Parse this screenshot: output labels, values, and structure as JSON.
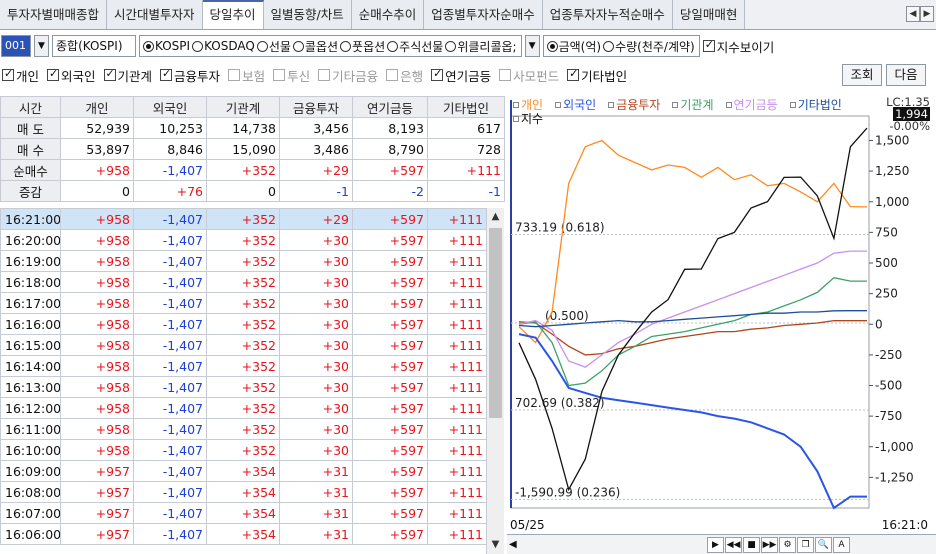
{
  "tabs": [
    "투자자별매매종합",
    "시간대별투자자",
    "당일추이",
    "일별동향/차트",
    "순매수추이",
    "업종별투자자순매수",
    "업종투자자누적순매수",
    "당일매매현"
  ],
  "tab_arrows": [
    "◀",
    "▶"
  ],
  "toolbar": {
    "code": "001",
    "code_dropdown": "▼",
    "market_select": "종합(KOSPI)",
    "market_radios": [
      "KOSPI",
      "KOSDAQ",
      "선물",
      "콜옵션",
      "풋옵션",
      "주식선물",
      "위클리콜옵;"
    ],
    "market_selected": "KOSPI",
    "market_dropdown": "▼",
    "unit_radios": [
      "금액(억)",
      "수량(천주/계약)"
    ],
    "unit_selected": "금액(억)",
    "show_index_label": "지수보이기",
    "show_index_checked": true
  },
  "filters": [
    {
      "label": "개인",
      "checked": true
    },
    {
      "label": "외국인",
      "checked": true
    },
    {
      "label": "기관계",
      "checked": true
    },
    {
      "label": "금융투자",
      "checked": true
    },
    {
      "label": "보험",
      "checked": false
    },
    {
      "label": "투신",
      "checked": false
    },
    {
      "label": "기타금융",
      "checked": false
    },
    {
      "label": "은행",
      "checked": false
    },
    {
      "label": "연기금등",
      "checked": true
    },
    {
      "label": "사모펀드",
      "checked": false
    },
    {
      "label": "기타법인",
      "checked": true
    }
  ],
  "buttons": {
    "query": "조회",
    "next": "다음"
  },
  "summary": {
    "headers": [
      "시간",
      "개인",
      "외국인",
      "기관계",
      "금융투자",
      "연기금등",
      "기타법인"
    ],
    "rows": [
      {
        "label": "매 도",
        "values": [
          "52,939",
          "10,253",
          "14,738",
          "3,456",
          "8,193",
          "617"
        ]
      },
      {
        "label": "매 수",
        "values": [
          "53,897",
          "8,846",
          "15,090",
          "3,486",
          "8,790",
          "728"
        ]
      },
      {
        "label": "순매수",
        "values": [
          "+958",
          "-1,407",
          "+352",
          "+29",
          "+597",
          "+111"
        ]
      },
      {
        "label": "증감",
        "values": [
          "0",
          "+76",
          "0",
          "-1",
          "-2",
          "-1"
        ]
      }
    ]
  },
  "timeseries": [
    {
      "time": "16:21:00",
      "values": [
        "+958",
        "-1,407",
        "+352",
        "+29",
        "+597",
        "+111"
      ]
    },
    {
      "time": "16:20:00",
      "values": [
        "+958",
        "-1,407",
        "+352",
        "+30",
        "+597",
        "+111"
      ]
    },
    {
      "time": "16:19:00",
      "values": [
        "+958",
        "-1,407",
        "+352",
        "+30",
        "+597",
        "+111"
      ]
    },
    {
      "time": "16:18:00",
      "values": [
        "+958",
        "-1,407",
        "+352",
        "+30",
        "+597",
        "+111"
      ]
    },
    {
      "time": "16:17:00",
      "values": [
        "+958",
        "-1,407",
        "+352",
        "+30",
        "+597",
        "+111"
      ]
    },
    {
      "time": "16:16:00",
      "values": [
        "+958",
        "-1,407",
        "+352",
        "+30",
        "+597",
        "+111"
      ]
    },
    {
      "time": "16:15:00",
      "values": [
        "+958",
        "-1,407",
        "+352",
        "+30",
        "+597",
        "+111"
      ]
    },
    {
      "time": "16:14:00",
      "values": [
        "+958",
        "-1,407",
        "+352",
        "+30",
        "+597",
        "+111"
      ]
    },
    {
      "time": "16:13:00",
      "values": [
        "+958",
        "-1,407",
        "+352",
        "+30",
        "+597",
        "+111"
      ]
    },
    {
      "time": "16:12:00",
      "values": [
        "+958",
        "-1,407",
        "+352",
        "+30",
        "+597",
        "+111"
      ]
    },
    {
      "time": "16:11:00",
      "values": [
        "+958",
        "-1,407",
        "+352",
        "+30",
        "+597",
        "+111"
      ]
    },
    {
      "time": "16:10:00",
      "values": [
        "+958",
        "-1,407",
        "+352",
        "+30",
        "+597",
        "+111"
      ]
    },
    {
      "time": "16:09:00",
      "values": [
        "+957",
        "-1,407",
        "+354",
        "+31",
        "+597",
        "+111"
      ]
    },
    {
      "time": "16:08:00",
      "values": [
        "+957",
        "-1,407",
        "+354",
        "+31",
        "+597",
        "+111"
      ]
    },
    {
      "time": "16:07:00",
      "values": [
        "+957",
        "-1,407",
        "+354",
        "+31",
        "+597",
        "+111"
      ]
    },
    {
      "time": "16:06:00",
      "values": [
        "+957",
        "-1,407",
        "+354",
        "+31",
        "+597",
        "+111"
      ]
    }
  ],
  "colors": {
    "positive": "#e8141c",
    "negative": "#1d3fd8",
    "selected_row": "#cfe4f6",
    "header_bg": "#eceef2",
    "code_bg": "#2c52b5"
  },
  "chart_data": {
    "type": "line",
    "legend": [
      {
        "name": "개인",
        "color": "#ff8a1e"
      },
      {
        "name": "외국인",
        "color": "#2b55e8"
      },
      {
        "name": "금융투자",
        "color": "#b0461c"
      },
      {
        "name": "기관계",
        "color": "#3ca26a"
      },
      {
        "name": "연기금등",
        "color": "#c98ef0"
      },
      {
        "name": "기타법인",
        "color": "#1c4f9a"
      },
      {
        "name": "지수",
        "color": "#111111"
      }
    ],
    "lc_label": "LC:1.35",
    "index_last": "1,994",
    "index_change": "-0.00%",
    "y_ticks": [
      "1,500",
      "1,250",
      "1,000",
      "750",
      "500",
      "250",
      "0",
      "-250",
      "-500",
      "-750",
      "-1,000",
      "-1,250"
    ],
    "ylim": [
      -1500,
      1700
    ],
    "annotations": [
      "733.19 (0.618)",
      "(0.500)",
      "702.69 (0.382)",
      "-1,590.99 (0.236)"
    ],
    "x_start": "05/25",
    "x_end": "16:21:0",
    "series": [
      {
        "name": "개인",
        "values": [
          -20,
          -150,
          100,
          1150,
          1450,
          1500,
          1380,
          1320,
          1260,
          1300,
          1280,
          1200,
          1280,
          1180,
          1220,
          1130,
          1150,
          1080,
          1000,
          1150,
          960,
          958
        ]
      },
      {
        "name": "외국인",
        "values": [
          -80,
          -110,
          -300,
          -520,
          -560,
          -600,
          -620,
          -640,
          -660,
          -680,
          -700,
          -720,
          -750,
          -770,
          -800,
          -850,
          -900,
          -1000,
          -1200,
          -1500,
          -1407,
          -1407
        ]
      },
      {
        "name": "금융투자",
        "values": [
          20,
          10,
          -80,
          -180,
          -250,
          -240,
          -200,
          -180,
          -150,
          -120,
          -100,
          -80,
          -60,
          -60,
          -40,
          -30,
          -10,
          0,
          10,
          30,
          29,
          29
        ]
      },
      {
        "name": "기관계",
        "values": [
          0,
          20,
          -150,
          -500,
          -480,
          -380,
          -250,
          -180,
          -100,
          -80,
          -60,
          -30,
          0,
          30,
          80,
          100,
          150,
          200,
          260,
          380,
          352,
          352
        ]
      },
      {
        "name": "연기금등",
        "values": [
          0,
          30,
          -50,
          -300,
          -350,
          -250,
          -150,
          -80,
          0,
          50,
          100,
          150,
          200,
          250,
          300,
          350,
          400,
          450,
          500,
          580,
          597,
          597
        ]
      },
      {
        "name": "기타법인",
        "values": [
          -10,
          -20,
          -10,
          0,
          10,
          20,
          30,
          20,
          20,
          30,
          40,
          50,
          60,
          70,
          80,
          90,
          90,
          100,
          100,
          110,
          111,
          111
        ]
      },
      {
        "name": "지수",
        "values": [
          -200,
          -400,
          -900,
          -1300,
          -1150,
          -500,
          -300,
          -20,
          50,
          250,
          400,
          500,
          650,
          800,
          900,
          1050,
          1150,
          1250,
          1000,
          750,
          1400,
          1650
        ]
      }
    ]
  }
}
